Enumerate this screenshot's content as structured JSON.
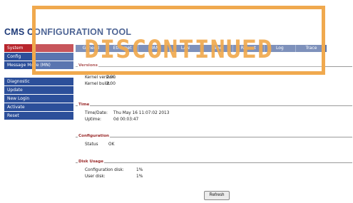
{
  "app": {
    "title": "CMS CONFIGURATION TOOL"
  },
  "sidebar": {
    "group1": [
      {
        "label": "System",
        "active": true
      },
      {
        "label": "Config",
        "active": false
      },
      {
        "label": "Message Mode (MN)",
        "active": false
      }
    ],
    "group2": [
      {
        "label": "Diagnostic"
      },
      {
        "label": "Update"
      },
      {
        "label": "New Login"
      },
      {
        "label": "Activate"
      },
      {
        "label": "Reset"
      }
    ]
  },
  "tabs": [
    "General",
    "Ethernet",
    "WAN",
    "LAN",
    "Time",
    "Reboot",
    "Log",
    "Trace"
  ],
  "sections": {
    "versions": {
      "title": "Versions",
      "rows": [
        {
          "label": "Kernel version:",
          "value": "2.00"
        },
        {
          "label": "Kernel build:",
          "value": "2.00"
        }
      ]
    },
    "time": {
      "title": "Time",
      "rows": [
        {
          "label": "Time/Date:",
          "value": "Thu May 16 11:07:02 2013"
        },
        {
          "label": "Uptime:",
          "value": "0d 00:03:47"
        }
      ]
    },
    "configuration": {
      "title": "Configuration",
      "rows": [
        {
          "label": "Status",
          "value": "OK"
        }
      ]
    },
    "disk_usage": {
      "title": "Disk Usage",
      "rows": [
        {
          "label": "Configuration disk:",
          "value": "1%"
        },
        {
          "label": "User disk:",
          "value": "1%"
        }
      ]
    }
  },
  "buttons": {
    "refresh": "Refresh"
  },
  "stamp": {
    "text": "DISCONTINUED",
    "color": "#f0a94e"
  },
  "colors": {
    "sidebar_active": "#b8262d",
    "sidebar_item": "#2c4f9a",
    "tabbar": "#5a73a8",
    "title": "#1d3a78"
  }
}
